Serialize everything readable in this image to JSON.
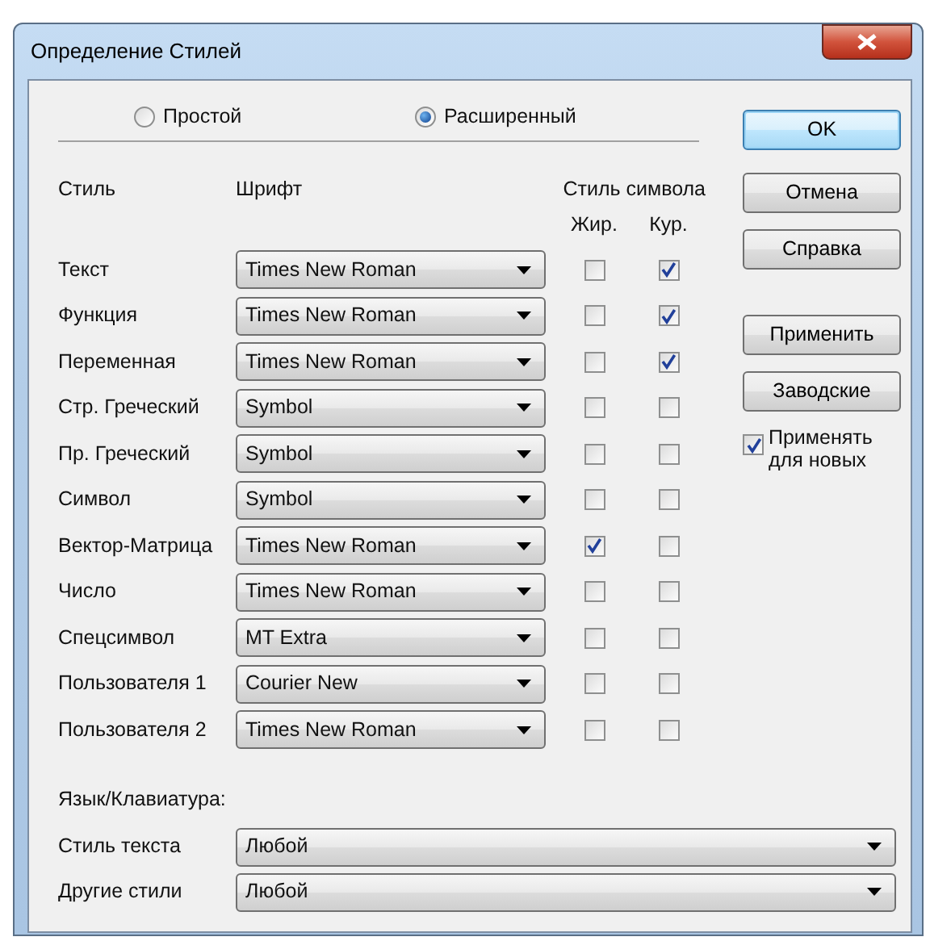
{
  "window": {
    "title": "Определение Стилей"
  },
  "mode_options": [
    {
      "label": "Простой",
      "selected": false
    },
    {
      "label": "Расширенный",
      "selected": true
    }
  ],
  "columns": {
    "style": "Стиль",
    "font": "Шрифт",
    "char_style": "Стиль символа",
    "bold": "Жир.",
    "italic": "Кур."
  },
  "styles": [
    {
      "name": "Текст",
      "font": "Times New Roman",
      "bold": false,
      "italic": true
    },
    {
      "name": "Функция",
      "font": "Times New Roman",
      "bold": false,
      "italic": true
    },
    {
      "name": "Переменная",
      "font": "Times New Roman",
      "bold": false,
      "italic": true
    },
    {
      "name": "Стр. Греческий",
      "font": "Symbol",
      "bold": false,
      "italic": false
    },
    {
      "name": "Пр. Греческий",
      "font": "Symbol",
      "bold": false,
      "italic": false
    },
    {
      "name": "Символ",
      "font": "Symbol",
      "bold": false,
      "italic": false
    },
    {
      "name": "Вектор-Матрица",
      "font": "Times New Roman",
      "bold": true,
      "italic": false
    },
    {
      "name": "Число",
      "font": "Times New Roman",
      "bold": false,
      "italic": false
    },
    {
      "name": "Спецсимвол",
      "font": "MT Extra",
      "bold": false,
      "italic": false
    },
    {
      "name": "Пользователя 1",
      "font": "Courier New",
      "bold": false,
      "italic": false
    },
    {
      "name": "Пользователя 2",
      "font": "Times New Roman",
      "bold": false,
      "italic": false
    }
  ],
  "language_section": {
    "title": "Язык/Клавиатура:",
    "fields": [
      {
        "label": "Стиль текста",
        "value": "Любой"
      },
      {
        "label": "Другие стили",
        "value": "Любой"
      }
    ]
  },
  "buttons": [
    {
      "label": "OK",
      "default": true
    },
    {
      "label": "Отмена",
      "default": false
    },
    {
      "label": "Справка",
      "default": false
    },
    {
      "label": "Применить",
      "default": false
    },
    {
      "label": "Заводские",
      "default": false
    }
  ],
  "apply_to_new": {
    "label": "Применять для новых",
    "checked": true
  }
}
